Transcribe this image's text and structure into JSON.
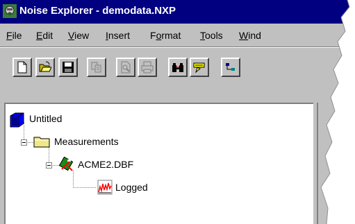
{
  "window": {
    "title": "Noise Explorer - demodata.NXP",
    "icon": "noise-explorer-app-icon"
  },
  "menu": [
    {
      "label": "File",
      "u": "F",
      "rest": "ile"
    },
    {
      "label": "Edit",
      "u": "E",
      "rest": "dit"
    },
    {
      "label": "View",
      "u": "V",
      "rest": "iew"
    },
    {
      "label": "Insert",
      "u": "I",
      "rest": "nsert"
    },
    {
      "label": "Format",
      "pre": "F",
      "u": "o",
      "rest": "rmat"
    },
    {
      "label": "Tools",
      "u": "T",
      "rest": "ools"
    },
    {
      "label": "Wind",
      "u": "W",
      "rest": "ind"
    }
  ],
  "toolbar": {
    "buttons": [
      {
        "icon": "new-document-icon"
      },
      {
        "icon": "open-folder-icon"
      },
      {
        "icon": "save-disk-icon"
      },
      {
        "icon": "copy-icon"
      },
      {
        "icon": "print-preview-icon"
      },
      {
        "icon": "print-icon"
      },
      {
        "icon": "binoculars-icon"
      },
      {
        "icon": "highlight-icon"
      },
      {
        "icon": "tree-view-icon"
      }
    ]
  },
  "tree": {
    "root": {
      "label": "Untitled",
      "icon": "project-icon"
    },
    "folder": {
      "label": "Measurements",
      "icon": "folder-icon"
    },
    "file": {
      "label": "ACME2.DBF",
      "icon": "meter-icon"
    },
    "child": {
      "label": "Logged",
      "icon": "logged-chart-icon"
    }
  },
  "colors": {
    "titlebar": "#000080",
    "face": "#c0c0c0",
    "folder": "#f0e68c"
  }
}
